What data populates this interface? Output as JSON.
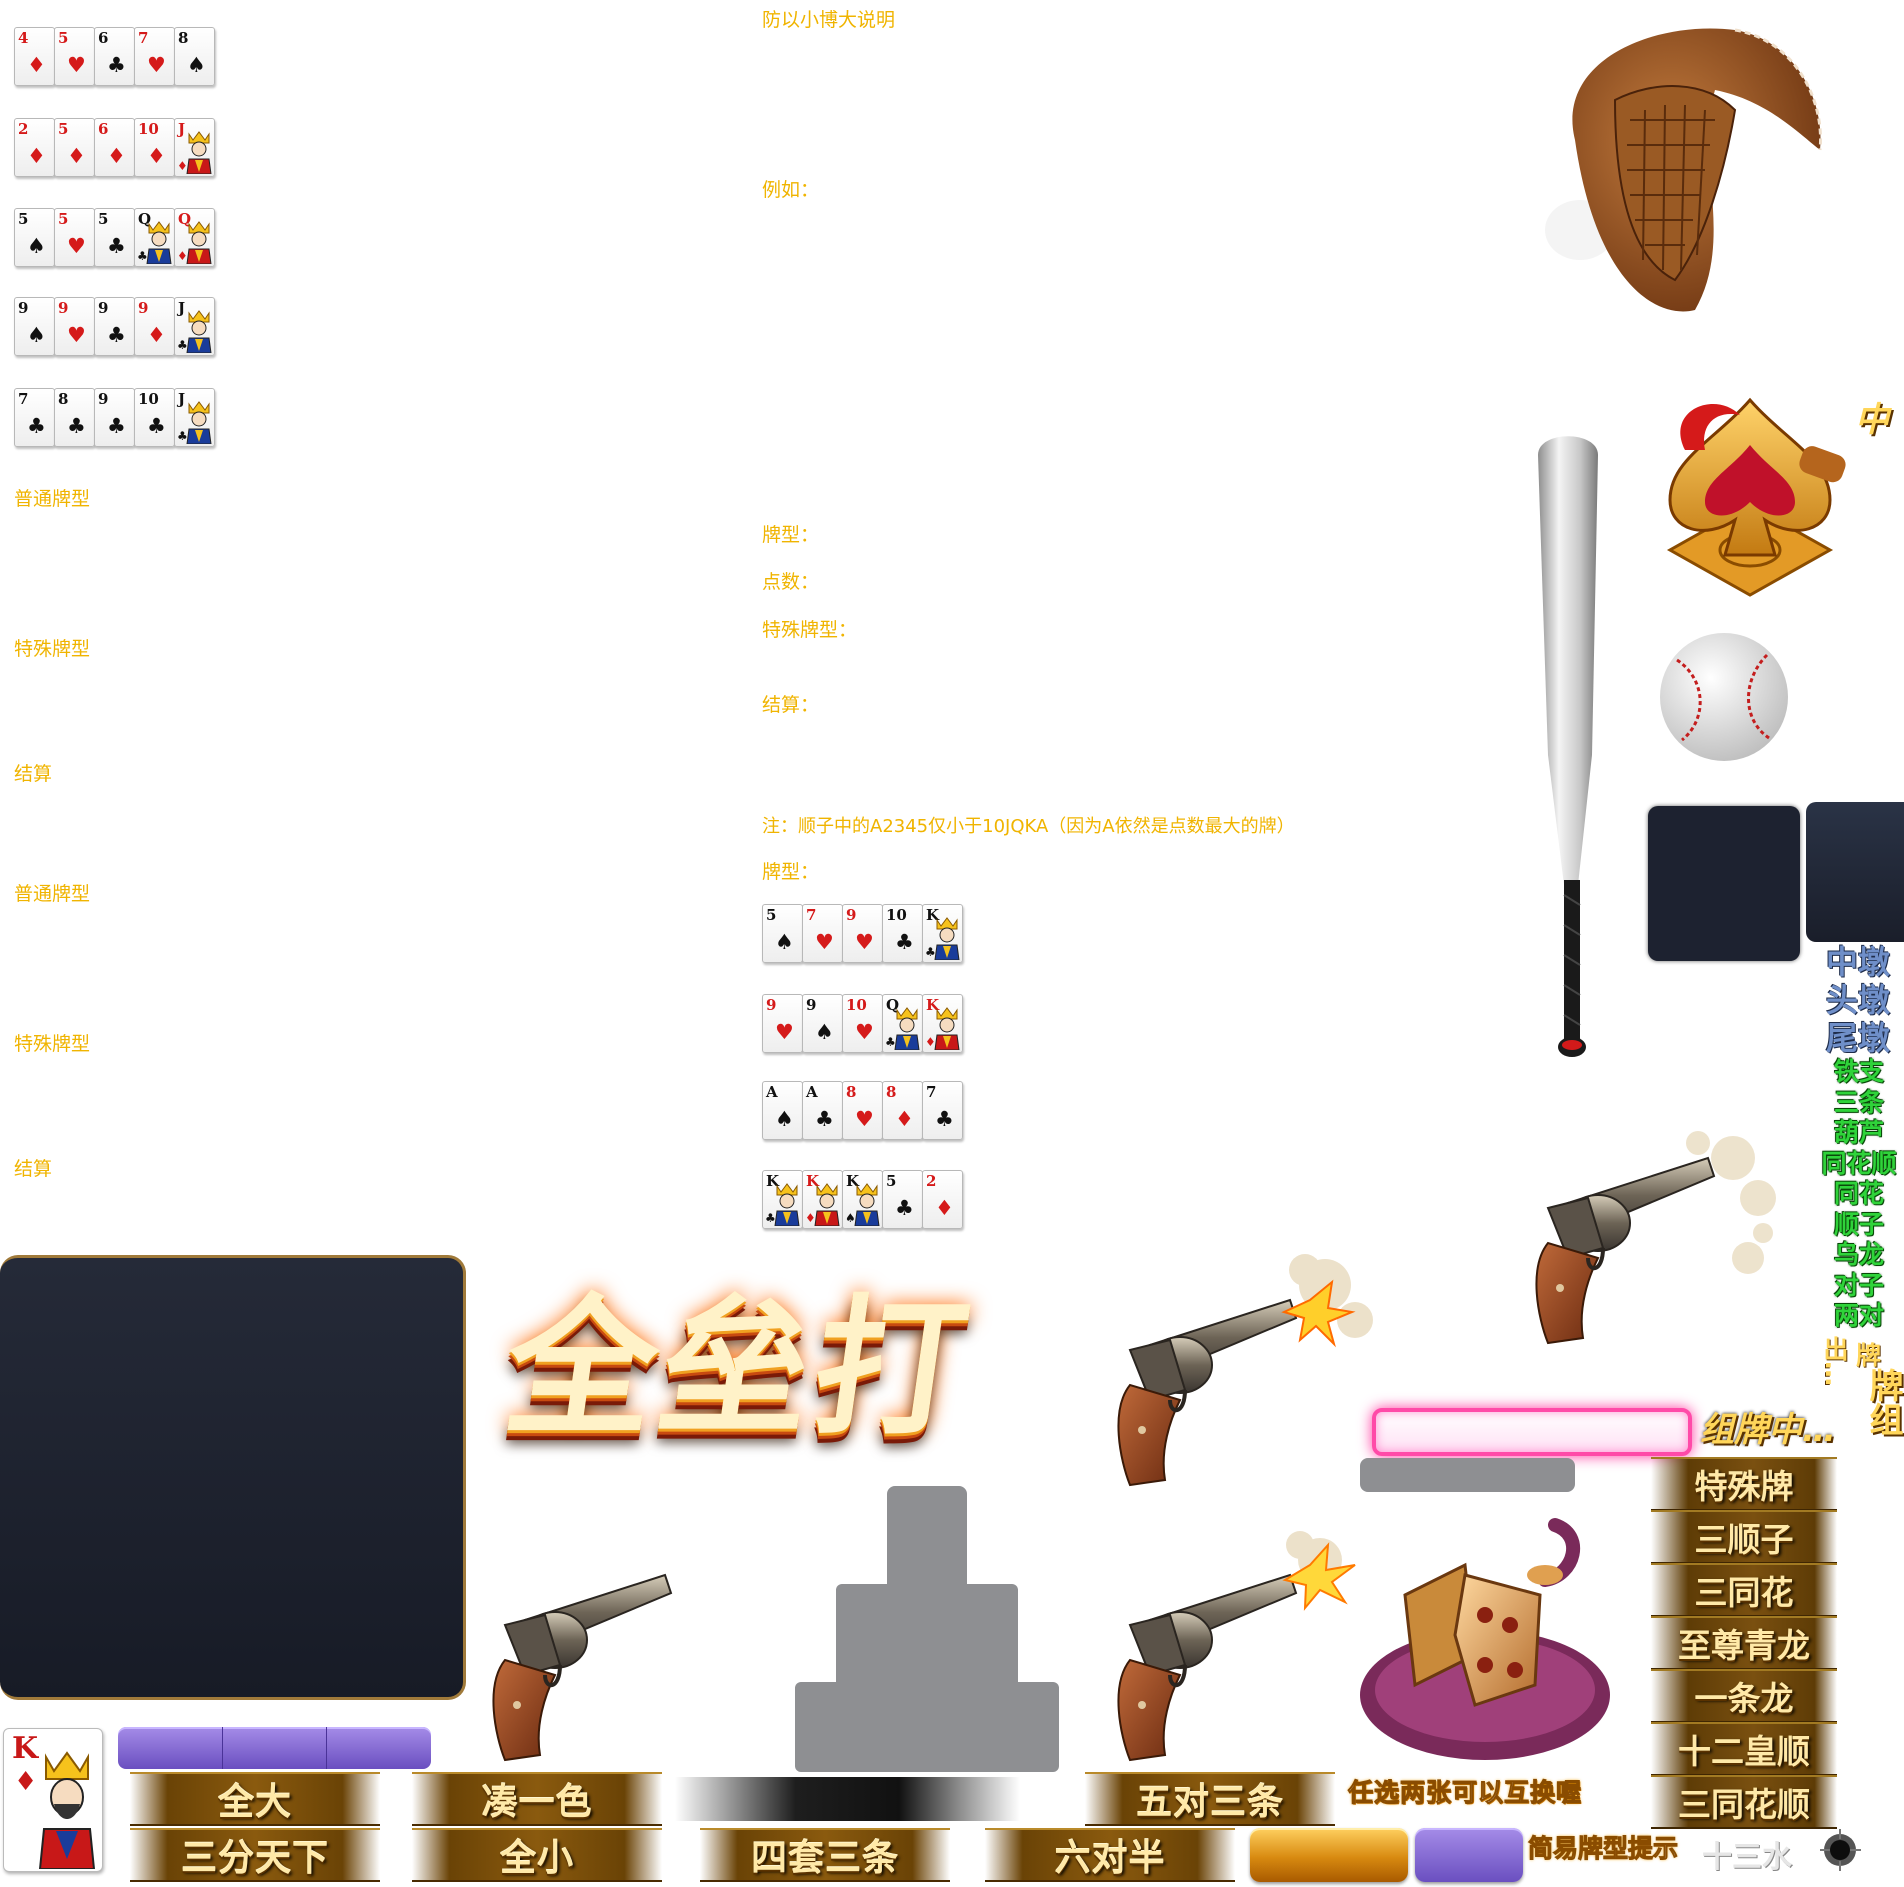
{
  "left_hands": [
    [
      {
        "r": "4",
        "s": "♦",
        "c": "red"
      },
      {
        "r": "5",
        "s": "♥",
        "c": "red"
      },
      {
        "r": "6",
        "s": "♣",
        "c": "blk"
      },
      {
        "r": "7",
        "s": "♥",
        "c": "red"
      },
      {
        "r": "8",
        "s": "♠",
        "c": "blk"
      }
    ],
    [
      {
        "r": "2",
        "s": "♦",
        "c": "red"
      },
      {
        "r": "5",
        "s": "♦",
        "c": "red"
      },
      {
        "r": "6",
        "s": "♦",
        "c": "red"
      },
      {
        "r": "10",
        "s": "♦",
        "c": "red"
      },
      {
        "r": "J",
        "s": "♦",
        "c": "red",
        "face": true
      }
    ],
    [
      {
        "r": "5",
        "s": "♠",
        "c": "blk"
      },
      {
        "r": "5",
        "s": "♥",
        "c": "red"
      },
      {
        "r": "5",
        "s": "♣",
        "c": "blk"
      },
      {
        "r": "Q",
        "s": "♣",
        "c": "blk",
        "face": true
      },
      {
        "r": "Q",
        "s": "♦",
        "c": "red",
        "face": true
      }
    ],
    [
      {
        "r": "9",
        "s": "♠",
        "c": "blk"
      },
      {
        "r": "9",
        "s": "♥",
        "c": "red"
      },
      {
        "r": "9",
        "s": "♣",
        "c": "blk"
      },
      {
        "r": "9",
        "s": "♦",
        "c": "red"
      },
      {
        "r": "J",
        "s": "♣",
        "c": "blk",
        "face": true
      }
    ],
    [
      {
        "r": "7",
        "s": "♣",
        "c": "blk"
      },
      {
        "r": "8",
        "s": "♣",
        "c": "blk"
      },
      {
        "r": "9",
        "s": "♣",
        "c": "blk"
      },
      {
        "r": "10",
        "s": "♣",
        "c": "blk"
      },
      {
        "r": "J",
        "s": "♣",
        "c": "blk",
        "face": true
      }
    ]
  ],
  "mid_hands": [
    [
      {
        "r": "5",
        "s": "♠",
        "c": "blk"
      },
      {
        "r": "7",
        "s": "♥",
        "c": "red"
      },
      {
        "r": "9",
        "s": "♥",
        "c": "red"
      },
      {
        "r": "10",
        "s": "♣",
        "c": "blk"
      },
      {
        "r": "K",
        "s": "♣",
        "c": "blk",
        "face": true
      }
    ],
    [
      {
        "r": "9",
        "s": "♥",
        "c": "red"
      },
      {
        "r": "9",
        "s": "♠",
        "c": "blk"
      },
      {
        "r": "10",
        "s": "♥",
        "c": "red"
      },
      {
        "r": "Q",
        "s": "♣",
        "c": "blk",
        "face": true
      },
      {
        "r": "K",
        "s": "♦",
        "c": "red",
        "face": true
      }
    ],
    [
      {
        "r": "A",
        "s": "♠",
        "c": "blk"
      },
      {
        "r": "A",
        "s": "♣",
        "c": "blk"
      },
      {
        "r": "8",
        "s": "♥",
        "c": "red"
      },
      {
        "r": "8",
        "s": "♦",
        "c": "red"
      },
      {
        "r": "7",
        "s": "♣",
        "c": "blk"
      }
    ],
    [
      {
        "r": "K",
        "s": "♣",
        "c": "blk",
        "face": true
      },
      {
        "r": "K",
        "s": "♦",
        "c": "red",
        "face": true
      },
      {
        "r": "K",
        "s": "♠",
        "c": "blk",
        "face": true
      },
      {
        "r": "5",
        "s": "♣",
        "c": "blk"
      },
      {
        "r": "2",
        "s": "♦",
        "c": "red"
      }
    ]
  ],
  "left_labels": {
    "normal1": "普通牌型",
    "special1": "特殊牌型",
    "settle1": "结算",
    "normal2": "普通牌型",
    "special2": "特殊牌型",
    "settle2": "结算"
  },
  "mid_text": {
    "heading": "防以小博大说明",
    "example": "例如：",
    "hand_type": "牌型：",
    "points": "点数：",
    "special": "特殊牌型：",
    "settle": "结算：",
    "note": "注：顺子中的A2345仅小于10JQKA（因为A依然是点数最大的牌）",
    "hand_type2": "牌型："
  },
  "banner": {
    "text": "全垒打"
  },
  "right_vertical": {
    "zhong": "中",
    "blue": [
      "中墩",
      "头墩",
      "尾墩"
    ],
    "green": [
      "铁支",
      "三条",
      "葫芦",
      "同花顺",
      "同花",
      "顺子",
      "乌龙",
      "对子",
      "两对"
    ],
    "chupai": "出…",
    "pai": "牌",
    "paizu": "牌组",
    "zupai": "组牌中…"
  },
  "side_tags": [
    "特殊牌",
    "三顺子",
    "三同花",
    "至尊青龙",
    "一条龙",
    "十二皇顺",
    "三同花顺"
  ],
  "bottom_tags_row1": [
    "全大",
    "凑一色",
    "五对三条"
  ],
  "bottom_tags_row2": [
    "三分天下",
    "全小",
    "四套三条",
    "六对半"
  ],
  "swap_hint": "任选两张可以互换喔",
  "easy_hint": "简易牌型提示",
  "shisan": "十三水",
  "king_card": {
    "rank": "K",
    "suit": "♦"
  }
}
